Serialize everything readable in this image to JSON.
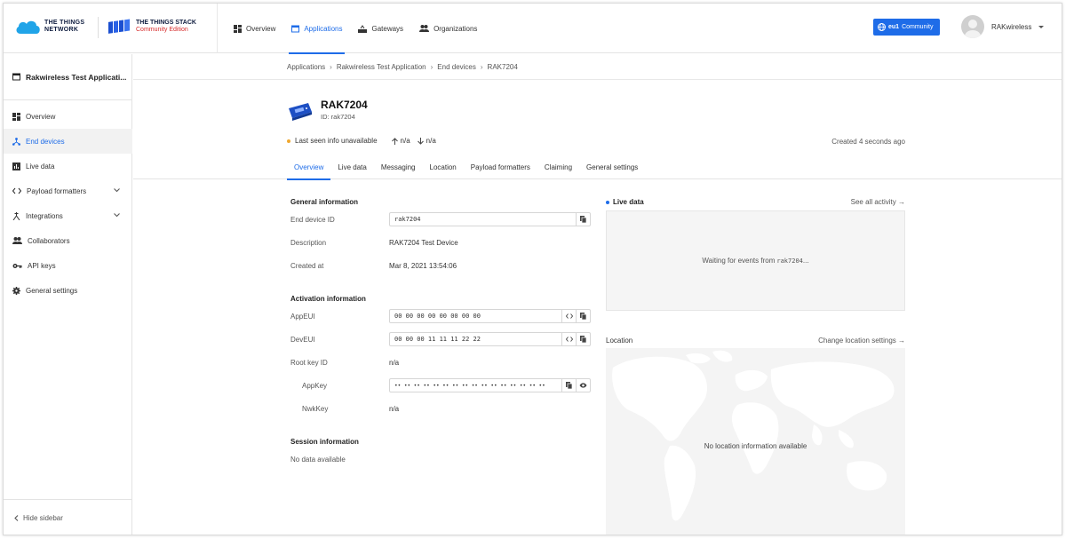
{
  "header": {
    "ttn_logo_line1": "THE THINGS",
    "ttn_logo_line2": "NETWORK",
    "stack_logo_line1": "THE THINGS STACK",
    "stack_logo_line2": "Community Edition",
    "nav": [
      {
        "label": "Overview",
        "icon": "overview-icon"
      },
      {
        "label": "Applications",
        "icon": "applications-icon"
      },
      {
        "label": "Gateways",
        "icon": "gateway-icon"
      },
      {
        "label": "Organizations",
        "icon": "organizations-icon"
      }
    ],
    "cluster_code": "eu1",
    "cluster_label": "Community",
    "user_name": "RAKwireless"
  },
  "sidebar": {
    "app_title": "Rakwireless Test Applicati...",
    "items": [
      {
        "label": "Overview"
      },
      {
        "label": "End devices"
      },
      {
        "label": "Live data"
      },
      {
        "label": "Payload formatters"
      },
      {
        "label": "Integrations"
      },
      {
        "label": "Collaborators"
      },
      {
        "label": "API keys"
      },
      {
        "label": "General settings"
      }
    ],
    "hide_label": "Hide sidebar"
  },
  "breadcrumb": [
    "Applications",
    "Rakwireless Test Application",
    "End devices",
    "RAK7204"
  ],
  "device": {
    "name": "RAK7204",
    "id_line": "ID: rak7204",
    "last_seen": "Last seen info unavailable",
    "uplink": "n/a",
    "downlink": "n/a",
    "created_ago": "Created 4 seconds ago"
  },
  "tabs": [
    "Overview",
    "Live data",
    "Messaging",
    "Location",
    "Payload formatters",
    "Claiming",
    "General settings"
  ],
  "general": {
    "title": "General information",
    "end_device_id_label": "End device ID",
    "end_device_id": "rak7204",
    "description_label": "Description",
    "description": "RAK7204 Test Device",
    "created_at_label": "Created at",
    "created_at": "Mar 8, 2021 13:54:06"
  },
  "activation": {
    "title": "Activation information",
    "appeui_label": "AppEUI",
    "appeui": "00 00 00 00 00 00 00 00",
    "deveui_label": "DevEUI",
    "deveui": "00 00 00 11 11 11 22 22",
    "root_key_id_label": "Root key ID",
    "root_key_id": "n/a",
    "appkey_label": "AppKey",
    "appkey": "•• •• •• •• •• •• •• •• •• •• •• •• •• •• •• ••",
    "nwkkey_label": "NwkKey",
    "nwkkey": "n/a"
  },
  "session": {
    "title": "Session information",
    "value": "No data available"
  },
  "live_data": {
    "title": "Live data",
    "see_all": "See all activity →",
    "waiting_prefix": "Waiting for events from ",
    "waiting_device": "rak7204",
    "waiting_suffix": "..."
  },
  "location": {
    "title": "Location",
    "change": "Change location settings →",
    "empty": "No location information available"
  }
}
